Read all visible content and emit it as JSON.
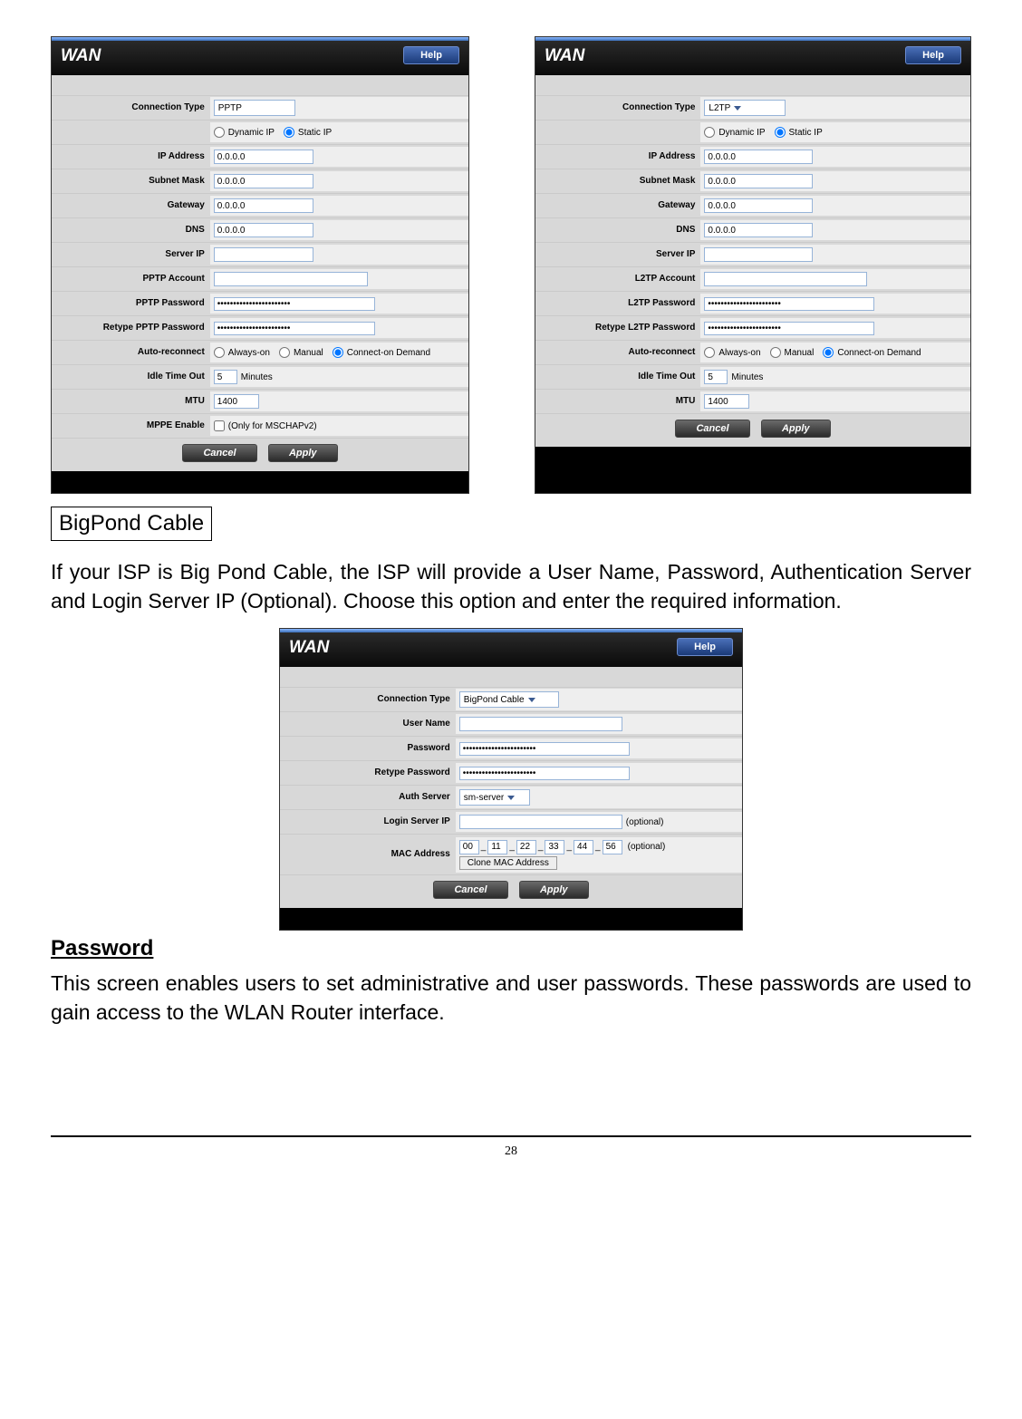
{
  "panel1": {
    "title": "WAN",
    "help": "Help",
    "connType_lbl": "Connection Type",
    "connType_val": "PPTP",
    "dynIP": "Dynamic IP",
    "staticIP": "Static IP",
    "ip_lbl": "IP Address",
    "ip_val": "0.0.0.0",
    "sn_lbl": "Subnet Mask",
    "sn_val": "0.0.0.0",
    "gw_lbl": "Gateway",
    "gw_val": "0.0.0.0",
    "dns_lbl": "DNS",
    "dns_val": "0.0.0.0",
    "sip_lbl": "Server IP",
    "sip_val": "",
    "acct_lbl": "PPTP Account",
    "acct_val": "",
    "pw_lbl": "PPTP Password",
    "pw_dots": "•••••••••••••••••••••••",
    "rpw_lbl": "Retype PPTP Password",
    "auto_lbl": "Auto-reconnect",
    "auto_always": "Always-on",
    "auto_manual": "Manual",
    "auto_cod": "Connect-on Demand",
    "idle_lbl": "Idle Time Out",
    "idle_val": "5",
    "idle_unit": "Minutes",
    "mtu_lbl": "MTU",
    "mtu_val": "1400",
    "mppe_lbl": "MPPE Enable",
    "mppe_note": "(Only for MSCHAPv2)",
    "cancel": "Cancel",
    "apply": "Apply"
  },
  "panel2": {
    "title": "WAN",
    "help": "Help",
    "connType_lbl": "Connection Type",
    "connType_val": "L2TP",
    "dynIP": "Dynamic IP",
    "staticIP": "Static IP",
    "ip_lbl": "IP Address",
    "ip_val": "0.0.0.0",
    "sn_lbl": "Subnet Mask",
    "sn_val": "0.0.0.0",
    "gw_lbl": "Gateway",
    "gw_val": "0.0.0.0",
    "dns_lbl": "DNS",
    "dns_val": "0.0.0.0",
    "sip_lbl": "Server IP",
    "sip_val": "",
    "acct_lbl": "L2TP Account",
    "acct_val": "",
    "pw_lbl": "L2TP Password",
    "pw_dots": "•••••••••••••••••••••••",
    "rpw_lbl": "Retype L2TP Password",
    "auto_lbl": "Auto-reconnect",
    "auto_always": "Always-on",
    "auto_manual": "Manual",
    "auto_cod": "Connect-on Demand",
    "idle_lbl": "Idle Time Out",
    "idle_val": "5",
    "idle_unit": "Minutes",
    "mtu_lbl": "MTU",
    "mtu_val": "1400",
    "cancel": "Cancel",
    "apply": "Apply"
  },
  "panel3": {
    "title": "WAN",
    "help": "Help",
    "connType_lbl": "Connection Type",
    "connType_val": "BigPond Cable",
    "user_lbl": "User Name",
    "user_val": "",
    "pw_lbl": "Password",
    "pw_dots": "•••••••••••••••••••••••",
    "rpw_lbl": "Retype Password",
    "auth_lbl": "Auth Server",
    "auth_val": "sm-server",
    "login_lbl": "Login Server IP",
    "login_val": "",
    "optional": "(optional)",
    "mac_lbl": "MAC Address",
    "mac": [
      "00",
      "11",
      "22",
      "33",
      "44",
      "56"
    ],
    "clone_btn": "Clone MAC Address",
    "cancel": "Cancel",
    "apply": "Apply"
  },
  "text": {
    "box_title": "BigPond Cable",
    "para1": "If your ISP is Big Pond Cable, the ISP will provide a User Name, Password, Authentication Server and Login Server IP (Optional).  Choose this option and enter the required information.",
    "password_h": "Password",
    "para2": "This screen enables users to set administrative and user passwords. These passwords are used to gain access to the WLAN Router interface.",
    "page_num": "28"
  }
}
